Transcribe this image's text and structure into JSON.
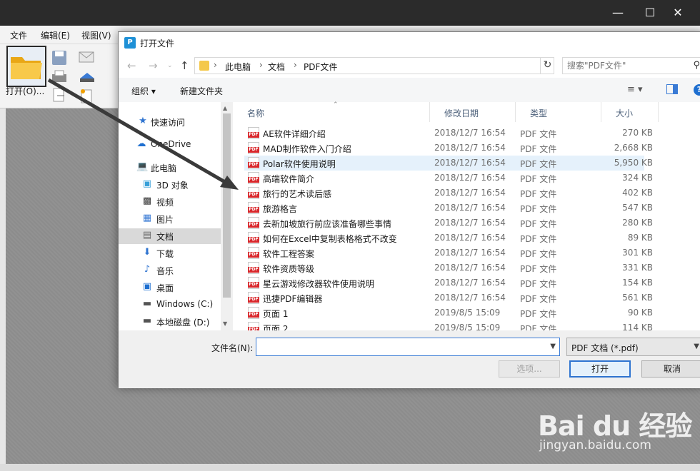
{
  "app": {
    "menu": [
      "文件",
      "编辑(E)",
      "视图(V)"
    ],
    "open_label": "打开(O)..."
  },
  "dialog": {
    "title": "打开文件",
    "breadcrumb": [
      "此电脑",
      "文档",
      "PDF文件"
    ],
    "search_placeholder": "搜索\"PDF文件\"",
    "organize": "组织 ▾",
    "new_folder": "新建文件夹"
  },
  "nav": [
    {
      "label": "快速访问",
      "icon": "star-icon"
    },
    {
      "label": "OneDrive",
      "icon": "cloud-icon"
    },
    {
      "label": "此电脑",
      "icon": "computer-icon"
    },
    {
      "label": "3D 对象",
      "icon": "cube-icon"
    },
    {
      "label": "视频",
      "icon": "video-icon"
    },
    {
      "label": "图片",
      "icon": "picture-icon"
    },
    {
      "label": "文档",
      "icon": "document-icon",
      "selected": true
    },
    {
      "label": "下载",
      "icon": "download-icon"
    },
    {
      "label": "音乐",
      "icon": "music-icon"
    },
    {
      "label": "桌面",
      "icon": "desktop-icon"
    },
    {
      "label": "Windows (C:)",
      "icon": "drive-icon"
    },
    {
      "label": "本地磁盘 (D:)",
      "icon": "disk-icon"
    }
  ],
  "columns": {
    "name": "名称",
    "date": "修改日期",
    "type": "类型",
    "size": "大小"
  },
  "files": [
    {
      "name": "AE软件详细介绍",
      "date": "2018/12/7 16:54",
      "type": "PDF 文件",
      "size": "270 KB"
    },
    {
      "name": "MAD制作软件入门介绍",
      "date": "2018/12/7 16:54",
      "type": "PDF 文件",
      "size": "2,668 KB"
    },
    {
      "name": "Polar软件使用说明",
      "date": "2018/12/7 16:54",
      "type": "PDF 文件",
      "size": "5,950 KB",
      "selected": true
    },
    {
      "name": "高端软件简介",
      "date": "2018/12/7 16:54",
      "type": "PDF 文件",
      "size": "324 KB"
    },
    {
      "name": "旅行的艺术读后感",
      "date": "2018/12/7 16:54",
      "type": "PDF 文件",
      "size": "402 KB"
    },
    {
      "name": "旅游格言",
      "date": "2018/12/7 16:54",
      "type": "PDF 文件",
      "size": "547 KB"
    },
    {
      "name": "去新加坡旅行前应该准备哪些事情",
      "date": "2018/12/7 16:54",
      "type": "PDF 文件",
      "size": "280 KB"
    },
    {
      "name": "如何在Excel中复制表格格式不改变",
      "date": "2018/12/7 16:54",
      "type": "PDF 文件",
      "size": "89 KB"
    },
    {
      "name": "软件工程答案",
      "date": "2018/12/7 16:54",
      "type": "PDF 文件",
      "size": "301 KB"
    },
    {
      "name": "软件资质等级",
      "date": "2018/12/7 16:54",
      "type": "PDF 文件",
      "size": "331 KB"
    },
    {
      "name": "星云游戏修改器软件使用说明",
      "date": "2018/12/7 16:54",
      "type": "PDF 文件",
      "size": "154 KB"
    },
    {
      "name": "迅捷PDF编辑器",
      "date": "2018/12/7 16:54",
      "type": "PDF 文件",
      "size": "561 KB"
    },
    {
      "name": "页面 1",
      "date": "2019/8/5 15:09",
      "type": "PDF 文件",
      "size": "90 KB"
    },
    {
      "name": "页面 2",
      "date": "2019/8/5 15:09",
      "type": "PDF 文件",
      "size": "114 KB"
    }
  ],
  "bottom": {
    "filename_label": "文件名(N):",
    "filename_value": "",
    "filetype": "PDF 文档 (*.pdf)",
    "options": "选项...",
    "open": "打开",
    "cancel": "取消"
  },
  "watermark": {
    "logo": "Bai du 经验",
    "url": "jingyan.baidu.com"
  }
}
